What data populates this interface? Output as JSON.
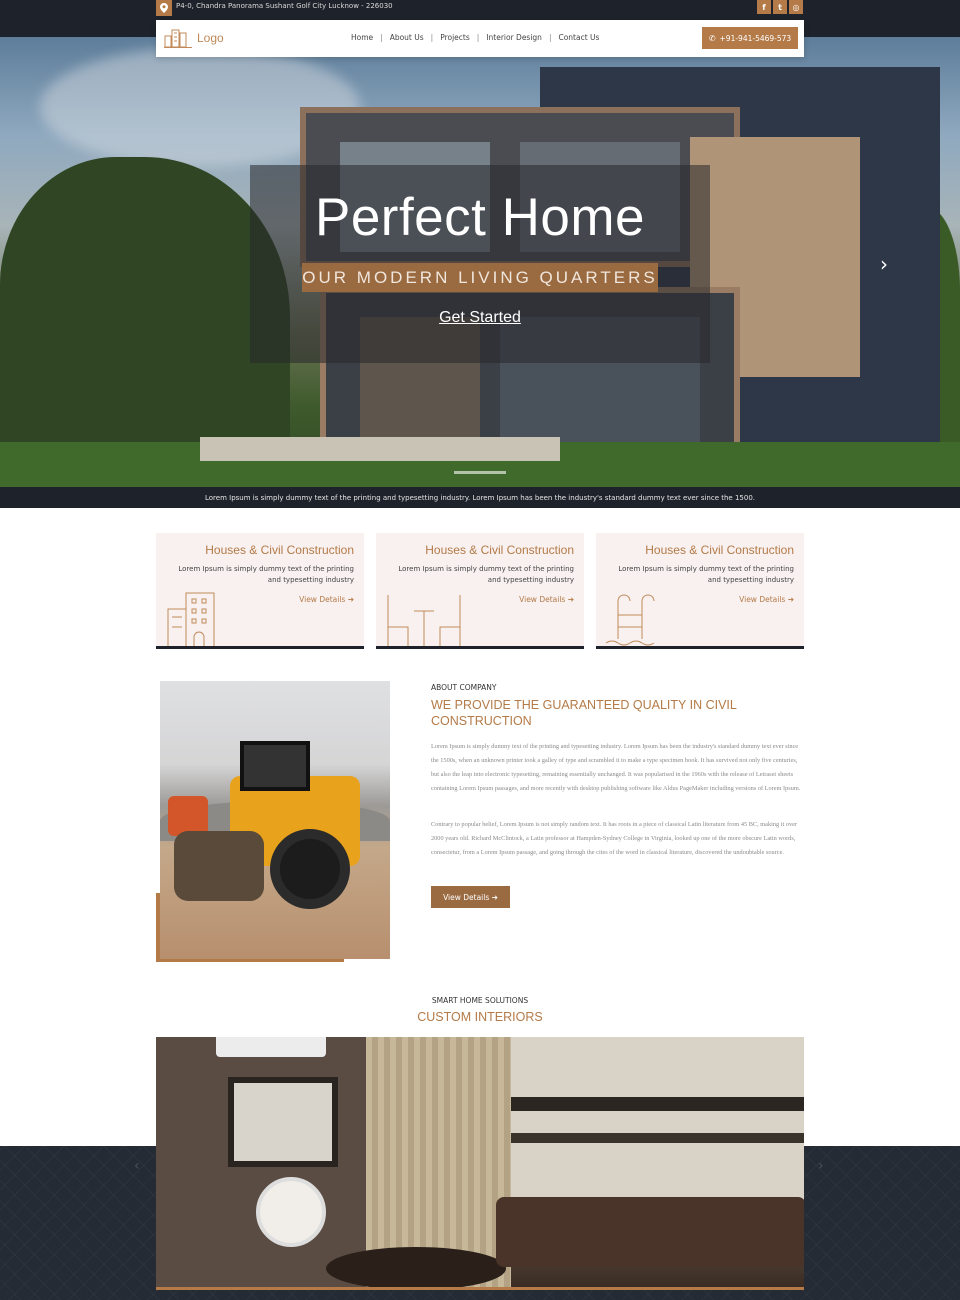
{
  "topbar": {
    "address": "P4-0, Chandra Panorama Sushant Golf City Lucknow - 226030",
    "social": [
      {
        "icon": "facebook-icon",
        "label": "f"
      },
      {
        "icon": "twitter-icon",
        "label": "t"
      },
      {
        "icon": "instagram-icon",
        "label": "◎"
      }
    ]
  },
  "nav": {
    "logo": "Logo",
    "items": [
      "Home",
      "About Us",
      "Projects",
      "Interior Design",
      "Contact Us"
    ],
    "phone": "+91-941-5469-573"
  },
  "hero": {
    "title": "Perfect Home",
    "subtitle": "OUR MODERN LIVING QUARTERS",
    "cta": "Get Started",
    "next_icon": "chevron-right-icon"
  },
  "ticker": "Lorem Ipsum is simply dummy text of the printing and typesetting industry. Lorem Ipsum has been the industry's standard dummy text ever since the 1500.",
  "cards": [
    {
      "title": "Houses & Civil Construction",
      "text": "Lorem Ipsum is simply dummy text of the printing and typesetting industry",
      "link": "View Details",
      "icon": "building-icon"
    },
    {
      "title": "Houses & Civil Construction",
      "text": "Lorem Ipsum is simply dummy text of the printing and typesetting industry",
      "link": "View Details",
      "icon": "dining-table-icon"
    },
    {
      "title": "Houses & Civil Construction",
      "text": "Lorem Ipsum is simply dummy text of the printing and typesetting industry",
      "link": "View Details",
      "icon": "pool-ladder-icon"
    }
  ],
  "about": {
    "kicker": "ABOUT COMPANY",
    "heading": "WE PROVIDE THE GUARANTEED QUALITY IN CIVIL CONSTRUCTION",
    "p1": "Lorem Ipsum is simply dummy text of the printing and typesetting industry. Lorem Ipsum has been the industry's standard dummy text ever since the 1500s, when an unknown printer took a galley of type and scrambled it to make a type specimen book. It has survived not only five centuries, but also the leap into electronic typesetting, remaining essentially unchanged. It was popularised in the 1960s with the release of Letraset sheets containing Lorem Ipsum passages, and more recently with desktop publishing software like Aldus PageMaker including versions of Lorem Ipsum.",
    "p2": "Contrary to popular belief, Lorem Ipsum is not simply random text. It has roots in a piece of classical Latin literature from 45 BC, making it over 2000 years old. Richard McClintock, a Latin professor at Hampden-Sydney College in Virginia, looked up one of the more obscure Latin words, consectetur, from a Lorem Ipsum passage, and going through the cites of the word in classical literature, discovered the undoubtable source.",
    "button": "View Details"
  },
  "interiors": {
    "kicker": "SMART HOME SOLUTIONS",
    "heading": "CUSTOM INTERIORS"
  },
  "colors": {
    "accent": "#b47a47",
    "dark": "#1e232b",
    "card_bg": "#f8f1f0"
  }
}
